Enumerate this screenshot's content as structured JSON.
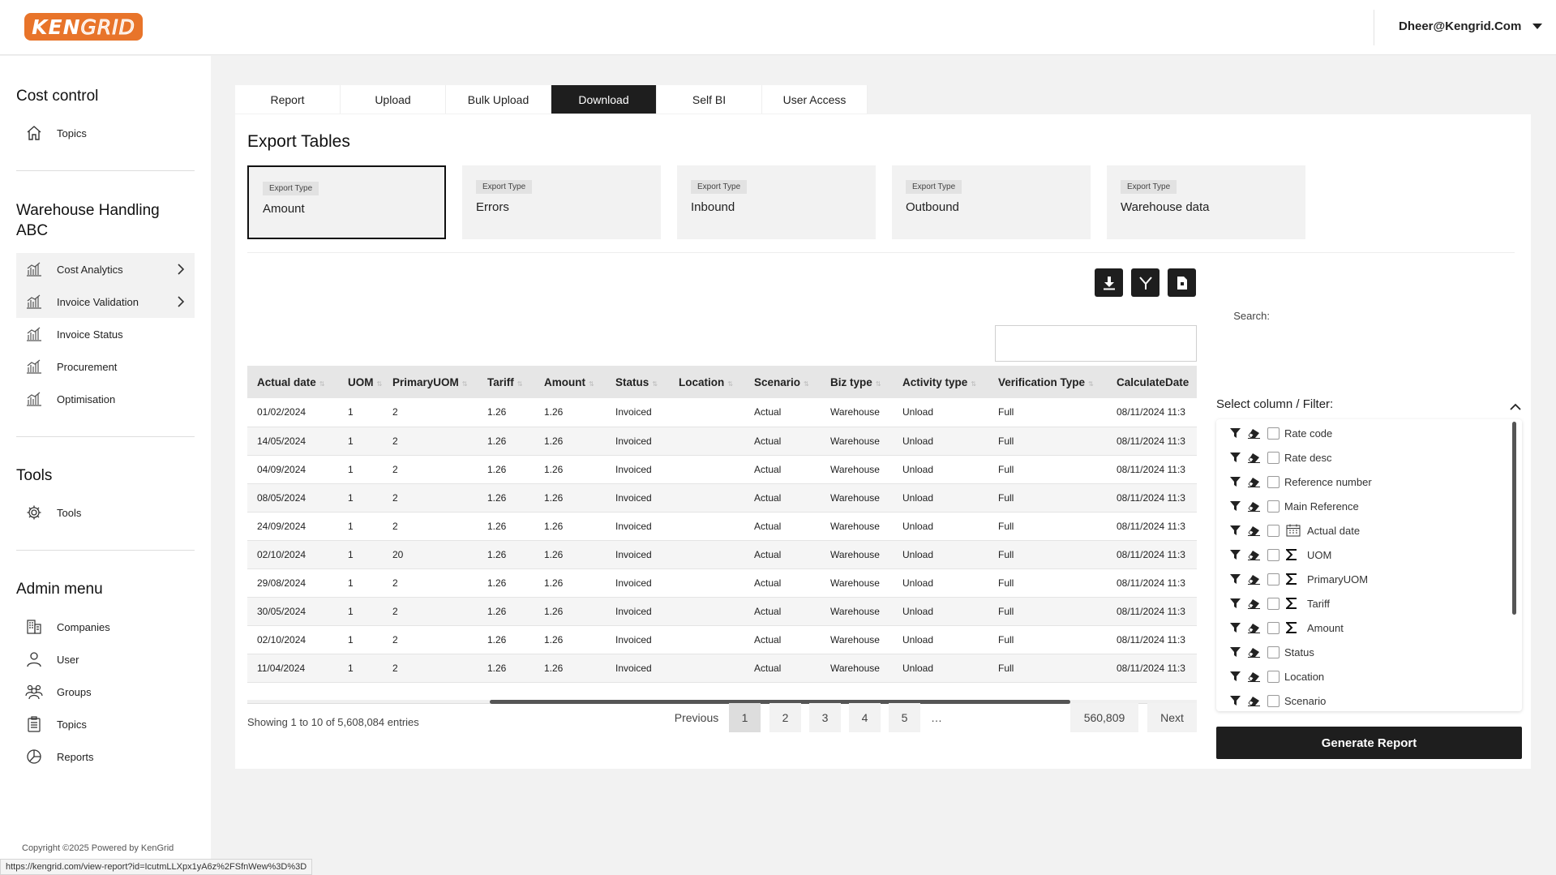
{
  "header": {
    "logo_text_a": "KEN",
    "logo_text_b": "GRID",
    "user_email": "Dheer@Kengrid.Com"
  },
  "sidebar": {
    "sections": [
      {
        "title": "Cost control",
        "items": [
          {
            "label": "Topics",
            "icon": "home-icon"
          }
        ]
      },
      {
        "title": "Warehouse Handling ABC",
        "items": [
          {
            "label": "Cost Analytics",
            "icon": "bar-chart-icon",
            "chevron": true
          },
          {
            "label": "Invoice Validation",
            "icon": "bar-chart-icon",
            "chevron": true
          },
          {
            "label": "Invoice Status",
            "icon": "bar-chart-icon"
          },
          {
            "label": "Procurement",
            "icon": "bar-chart-icon"
          },
          {
            "label": "Optimisation",
            "icon": "bar-chart-icon"
          }
        ]
      },
      {
        "title": "Tools",
        "items": [
          {
            "label": "Tools",
            "icon": "gear-icon"
          }
        ]
      },
      {
        "title": "Admin menu",
        "items": [
          {
            "label": "Companies",
            "icon": "building-icon"
          },
          {
            "label": "User",
            "icon": "user-icon"
          },
          {
            "label": "Groups",
            "icon": "users-icon"
          },
          {
            "label": "Topics",
            "icon": "clipboard-icon"
          },
          {
            "label": "Reports",
            "icon": "pie-chart-icon"
          }
        ]
      }
    ],
    "copyright": "Copyright ©2025 Powered by KenGrid",
    "status_url": "https://kengrid.com/view-report?id=IcutmLLXpx1yA6z%2FSfnWew%3D%3D"
  },
  "tabs": [
    "Report",
    "Upload",
    "Bulk Upload",
    "Download",
    "Self BI",
    "User Access"
  ],
  "active_tab": "Download",
  "export": {
    "title": "Export Tables",
    "tag_label": "Export Type",
    "types": [
      "Amount",
      "Errors",
      "Inbound",
      "Outbound",
      "Warehouse data"
    ],
    "active": "Amount"
  },
  "toolbar": {
    "icons": [
      "download-icon",
      "merge-icon",
      "file-icon"
    ],
    "search_label": "Search:",
    "search_value": ""
  },
  "table": {
    "columns": [
      "Actual date",
      "UOM",
      "PrimaryUOM",
      "Tariff",
      "Amount",
      "Status",
      "Location",
      "Scenario",
      "Biz type",
      "Activity type",
      "Verification Type",
      "CalculateDate"
    ],
    "rows": [
      [
        "01/02/2024",
        "1",
        "2",
        "1.26",
        "1.26",
        "Invoiced",
        "",
        "Actual",
        "Warehouse",
        "Unload",
        "Full",
        "08/11/2024 11:3"
      ],
      [
        "14/05/2024",
        "1",
        "2",
        "1.26",
        "1.26",
        "Invoiced",
        "",
        "Actual",
        "Warehouse",
        "Unload",
        "Full",
        "08/11/2024 11:3"
      ],
      [
        "04/09/2024",
        "1",
        "2",
        "1.26",
        "1.26",
        "Invoiced",
        "",
        "Actual",
        "Warehouse",
        "Unload",
        "Full",
        "08/11/2024 11:3"
      ],
      [
        "08/05/2024",
        "1",
        "2",
        "1.26",
        "1.26",
        "Invoiced",
        "",
        "Actual",
        "Warehouse",
        "Unload",
        "Full",
        "08/11/2024 11:3"
      ],
      [
        "24/09/2024",
        "1",
        "2",
        "1.26",
        "1.26",
        "Invoiced",
        "",
        "Actual",
        "Warehouse",
        "Unload",
        "Full",
        "08/11/2024 11:3"
      ],
      [
        "02/10/2024",
        "1",
        "20",
        "1.26",
        "1.26",
        "Invoiced",
        "",
        "Actual",
        "Warehouse",
        "Unload",
        "Full",
        "08/11/2024 11:3"
      ],
      [
        "29/08/2024",
        "1",
        "2",
        "1.26",
        "1.26",
        "Invoiced",
        "",
        "Actual",
        "Warehouse",
        "Unload",
        "Full",
        "08/11/2024 11:3"
      ],
      [
        "30/05/2024",
        "1",
        "2",
        "1.26",
        "1.26",
        "Invoiced",
        "",
        "Actual",
        "Warehouse",
        "Unload",
        "Full",
        "08/11/2024 11:3"
      ],
      [
        "02/10/2024",
        "1",
        "2",
        "1.26",
        "1.26",
        "Invoiced",
        "",
        "Actual",
        "Warehouse",
        "Unload",
        "Full",
        "08/11/2024 11:3"
      ],
      [
        "11/04/2024",
        "1",
        "2",
        "1.26",
        "1.26",
        "Invoiced",
        "",
        "Actual",
        "Warehouse",
        "Unload",
        "Full",
        "08/11/2024 11:3"
      ]
    ],
    "entries_text": "Showing 1 to 10 of 5,608,084 entries"
  },
  "pagination": {
    "previous": "Previous",
    "pages": [
      "1",
      "2",
      "3",
      "4",
      "5"
    ],
    "ellipsis": "…",
    "last": "560,809",
    "next": "Next",
    "current": "1"
  },
  "column_filter": {
    "title": "Select column / Filter:",
    "items": [
      {
        "label": "Rate code",
        "type": ""
      },
      {
        "label": "Rate desc",
        "type": ""
      },
      {
        "label": "Reference number",
        "type": ""
      },
      {
        "label": "Main Reference",
        "type": ""
      },
      {
        "label": "Actual date",
        "type": "calendar-icon"
      },
      {
        "label": "UOM",
        "type": "sigma-icon"
      },
      {
        "label": "PrimaryUOM",
        "type": "sigma-icon"
      },
      {
        "label": "Tariff",
        "type": "sigma-icon"
      },
      {
        "label": "Amount",
        "type": "sigma-icon"
      },
      {
        "label": "Status",
        "type": ""
      },
      {
        "label": "Location",
        "type": ""
      },
      {
        "label": "Scenario",
        "type": ""
      }
    ],
    "button_label": "Generate Report"
  }
}
